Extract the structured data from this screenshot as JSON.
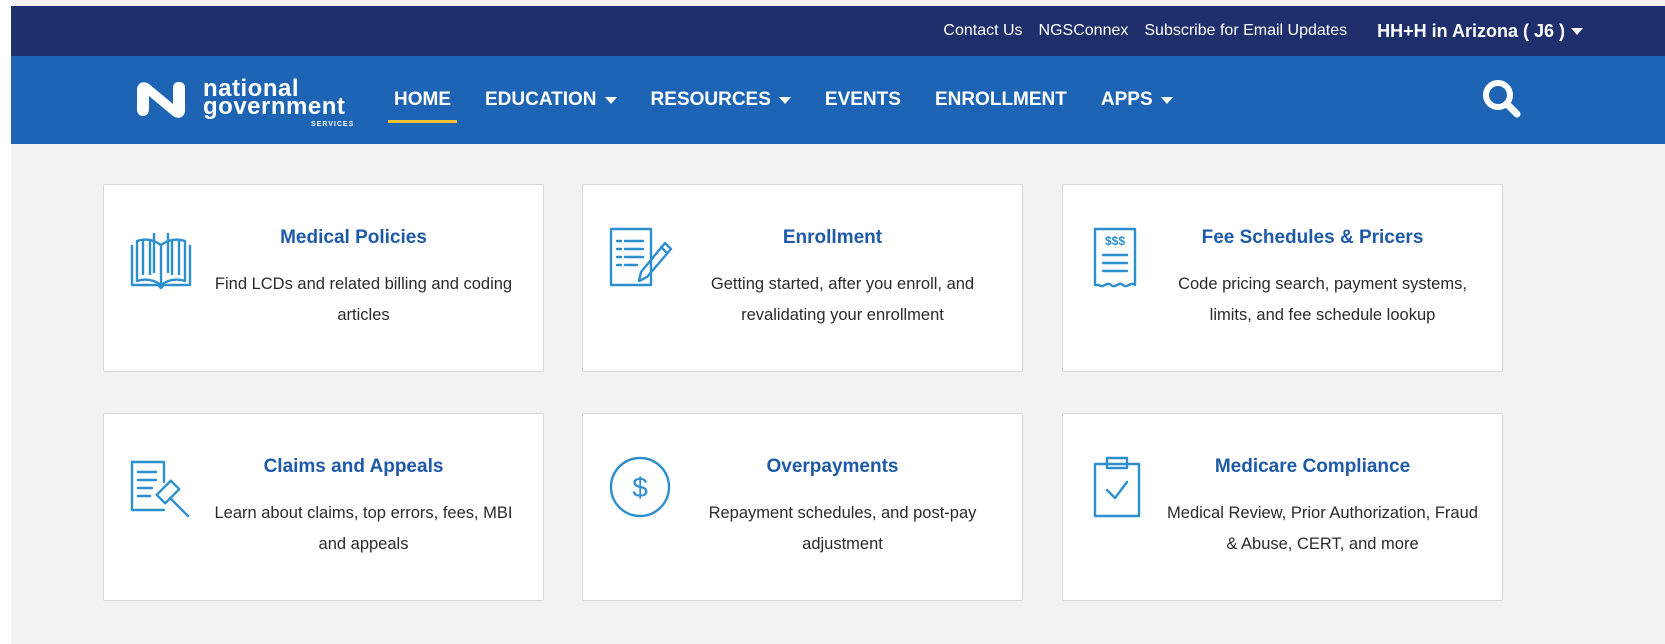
{
  "top_bar": {
    "links": [
      "Contact Us",
      "NGSConnex",
      "Subscribe for Email Updates"
    ],
    "region_label": "HH+H in Arizona ( J6 )"
  },
  "logo": {
    "line1": "national",
    "line2": "government",
    "line3": "SERVICES"
  },
  "nav": {
    "items": [
      {
        "label": "HOME",
        "active": true,
        "dropdown": false
      },
      {
        "label": "EDUCATION",
        "dropdown": true
      },
      {
        "label": "RESOURCES",
        "dropdown": true
      },
      {
        "label": "EVENTS",
        "dropdown": false
      },
      {
        "label": "ENROLLMENT",
        "dropdown": false
      },
      {
        "label": "APPS",
        "dropdown": true
      }
    ],
    "search_icon": "search-icon"
  },
  "cards": [
    {
      "title": "Medical Policies",
      "desc": "Find LCDs and related billing and coding articles",
      "icon": "book-icon"
    },
    {
      "title": "Enrollment",
      "desc": "Getting started, after you enroll, and revalidating your enrollment",
      "icon": "form-pencil-icon"
    },
    {
      "title": "Fee Schedules & Pricers",
      "desc": "Code pricing search, payment systems, limits, and fee schedule lookup",
      "icon": "receipt-icon",
      "icon_text": "$$$"
    },
    {
      "title": "Claims and Appeals",
      "desc": "Learn about claims, top errors, fees, MBI and appeals",
      "icon": "gavel-document-icon"
    },
    {
      "title": "Overpayments",
      "desc": "Repayment schedules, and post-pay adjustment",
      "icon": "dollar-circle-icon",
      "icon_text": "$"
    },
    {
      "title": "Medicare Compliance",
      "desc": "Medical Review, Prior Authorization, Fraud & Abuse, CERT, and more",
      "icon": "clipboard-check-icon"
    }
  ],
  "colors": {
    "top_bar": "#1f2f6b",
    "nav_bar": "#1e64b4",
    "accent": "#f2c232",
    "card_title": "#1e5aa8",
    "icon": "#2e8fce"
  }
}
